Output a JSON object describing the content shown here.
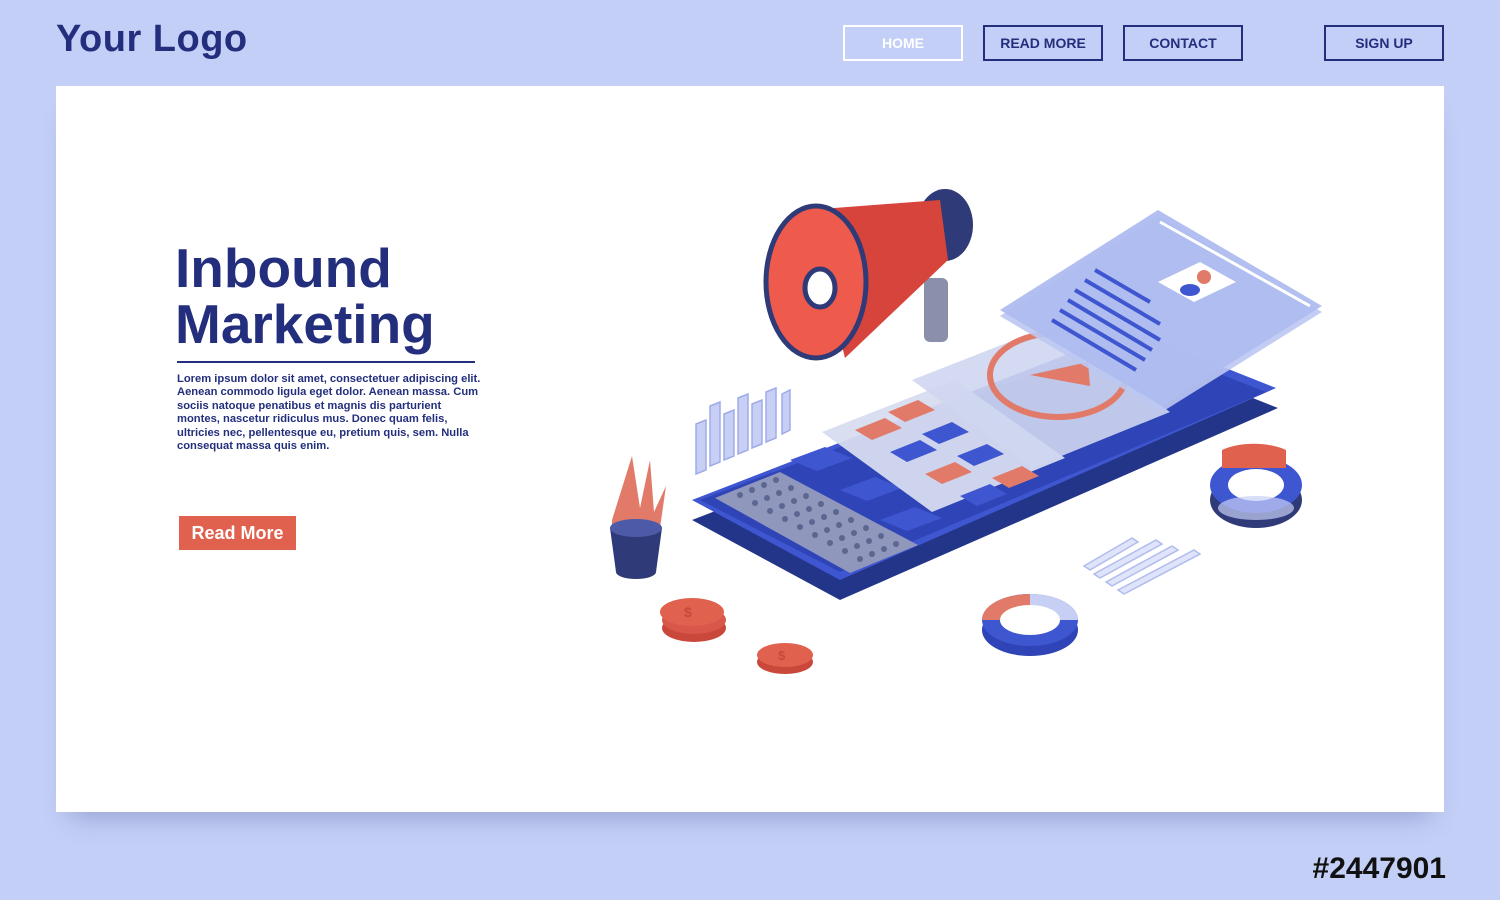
{
  "header": {
    "logo": "Your Logo",
    "nav": [
      {
        "label": "HOME"
      },
      {
        "label": "READ MORE"
      },
      {
        "label": "CONTACT"
      }
    ],
    "signup": "SIGN UP"
  },
  "hero": {
    "title_line1": "Inbound",
    "title_line2": "Marketing",
    "body": "Lorem ipsum dolor sit amet, consectetuer adipiscing elit. Aenean commodo ligula eget dolor. Aenean massa. Cum sociis natoque penatibus et magnis dis parturient montes, nascetur ridiculus mus. Donec quam felis, ultricies nec, pellentesque eu, pretium quis, sem. Nulla consequat massa quis enim.",
    "button": "Read More"
  },
  "stock_id": "#2447901",
  "colors": {
    "background": "#c3cff7",
    "navy": "#232f7d",
    "accent_red": "#e1614f",
    "phone_blue": "#3f56d1",
    "card": "#ffffff"
  },
  "icons": {
    "megaphone": "megaphone-icon",
    "smartphone": "smartphone-icon",
    "coins": "dollar-coin-icon",
    "plant": "potted-plant-icon",
    "play": "play-icon",
    "avatar": "user-avatar-icon"
  }
}
